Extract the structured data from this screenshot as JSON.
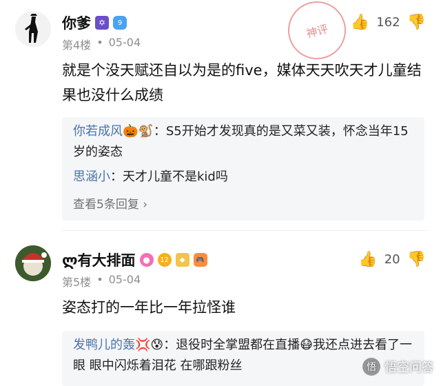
{
  "comments": [
    {
      "name": "你爹",
      "floor": "第4楼",
      "date": "05-04",
      "likes": "162",
      "body": "就是个没天赋还自以为是的five，媒体天天吹天才儿童结果也没什么成绩",
      "badges": [
        "star-of-david-icon",
        "diamond-9-icon"
      ],
      "stamp": "神评",
      "replies": [
        {
          "who": "你若成风",
          "emoji": "🎃🐒",
          "text": "：S5开始才发现真的是又菜又装，怀念当年15岁的姿态"
        },
        {
          "who": "思涵小",
          "emoji": "",
          "text": "：天才儿童不是kid吗"
        }
      ],
      "view_more": "查看5条回复 ›"
    },
    {
      "name": "ლ有大排面",
      "floor": "第5楼",
      "date": "05-04",
      "likes": "20",
      "body": "姿态打的一年比一年拉怪谁",
      "badges": [
        "lollipop-icon",
        "level-12-icon",
        "diamond-icon",
        "gamepad-icon"
      ],
      "replies": [
        {
          "who": "发鸭儿的轰",
          "emoji": "💢😰",
          "text": "：退役时全掌盟都在直播😷我还点进去看了一眼 眼中闪烁着泪花 在哪跟粉丝"
        }
      ]
    }
  ],
  "watermark": "悟空问答"
}
